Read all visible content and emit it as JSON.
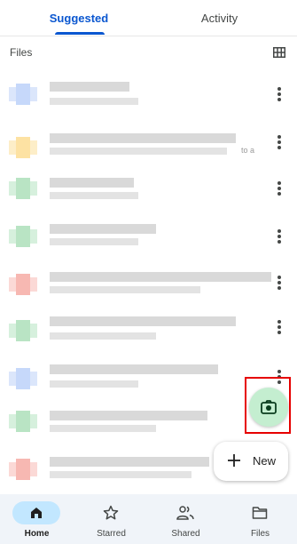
{
  "tabs": [
    {
      "label": "Suggested",
      "active": true
    },
    {
      "label": "Activity",
      "active": false
    }
  ],
  "files_section": {
    "title": "Files",
    "view_toggle_icon": "grid-view-icon"
  },
  "file_list": {
    "items_blurred": true,
    "visible_text_fragments": [
      "to a"
    ],
    "item_count": 8
  },
  "camera_fab": {
    "icon": "camera-icon",
    "highlighted": true
  },
  "new_fab": {
    "label": "New",
    "icon": "plus-icon"
  },
  "bottom_nav": {
    "items": [
      {
        "label": "Home",
        "icon": "home-icon",
        "active": true
      },
      {
        "label": "Starred",
        "icon": "star-icon",
        "active": false
      },
      {
        "label": "Shared",
        "icon": "shared-people-icon",
        "active": false
      },
      {
        "label": "Files",
        "icon": "folder-icon",
        "active": false
      }
    ]
  },
  "colors": {
    "accent": "#0b57d0",
    "active_nav_pill": "#c2e7ff",
    "camera_fab_bg": "#c4eed0",
    "highlight_box": "#e60000",
    "thumb_blue": "#4285f4",
    "thumb_yellow": "#fbbc04",
    "thumb_green": "#34a853",
    "thumb_red": "#ea4335"
  }
}
